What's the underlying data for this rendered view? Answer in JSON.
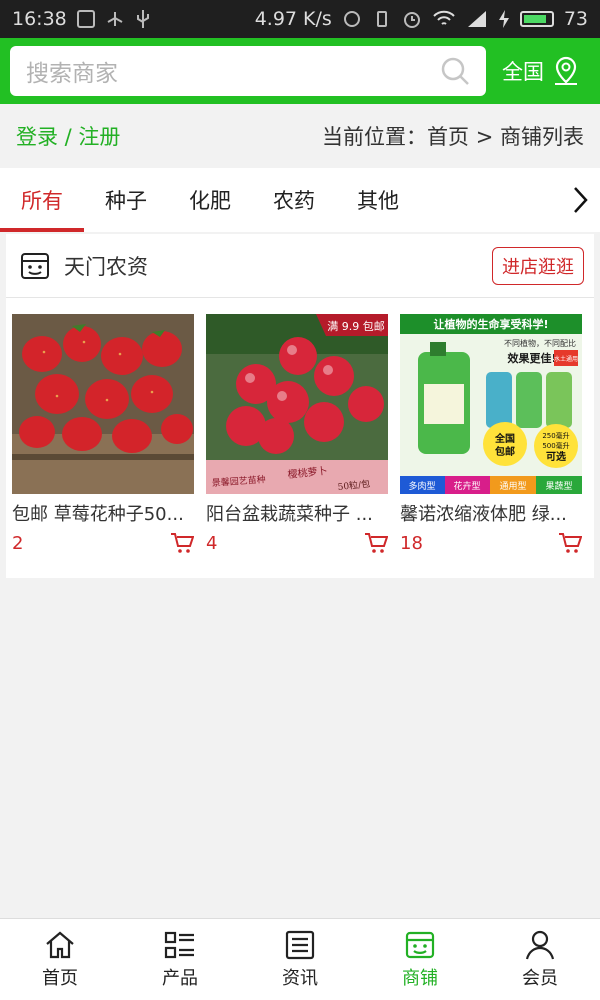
{
  "status_bar": {
    "time": "16:38",
    "network_speed": "4.97 K/s",
    "battery": "73"
  },
  "header": {
    "search_placeholder": "搜索商家",
    "region": "全国"
  },
  "breadcrumb": {
    "auth": "登录 / 注册",
    "location": "当前位置：首页 > 商铺列表"
  },
  "tabs": [
    {
      "label": "所有",
      "active": true
    },
    {
      "label": "种子",
      "active": false
    },
    {
      "label": "化肥",
      "active": false
    },
    {
      "label": "农药",
      "active": false
    },
    {
      "label": "其他",
      "active": false
    }
  ],
  "store": {
    "name": "天门农资",
    "visit_label": "进店逛逛",
    "products": [
      {
        "title": "包邮 草莓花种子50...",
        "price": "2"
      },
      {
        "title": "阳台盆栽蔬菜种子 ...",
        "price": "4",
        "image_texts": {
          "badge": "满 9.9 包邮",
          "sign_left": "景馨园艺苗种",
          "sign_mid": "樱桃萝卜",
          "sign_right": "50粒/包"
        }
      },
      {
        "title": "馨诺浓缩液体肥 绿...",
        "price": "18",
        "image_texts": {
          "banner": "让植物的生命享受科学!",
          "line1": "不同植物，不同配比",
          "line2": "效果更佳!",
          "tag": "水土通用",
          "circle1": "全国",
          "circle2": "包邮",
          "size1": "250毫升",
          "size2": "500毫升",
          "size3": "可选",
          "types": [
            "多肉型",
            "花卉型",
            "通用型",
            "果蔬型"
          ]
        }
      }
    ]
  },
  "bottom_nav": [
    {
      "label": "首页",
      "icon": "home-icon",
      "active": false
    },
    {
      "label": "产品",
      "icon": "list-icon",
      "active": false
    },
    {
      "label": "资讯",
      "icon": "news-icon",
      "active": false
    },
    {
      "label": "商铺",
      "icon": "store-icon",
      "active": true
    },
    {
      "label": "会员",
      "icon": "user-icon",
      "active": false
    }
  ],
  "colors": {
    "brand_green": "#22c023",
    "accent_red": "#d0282a"
  }
}
